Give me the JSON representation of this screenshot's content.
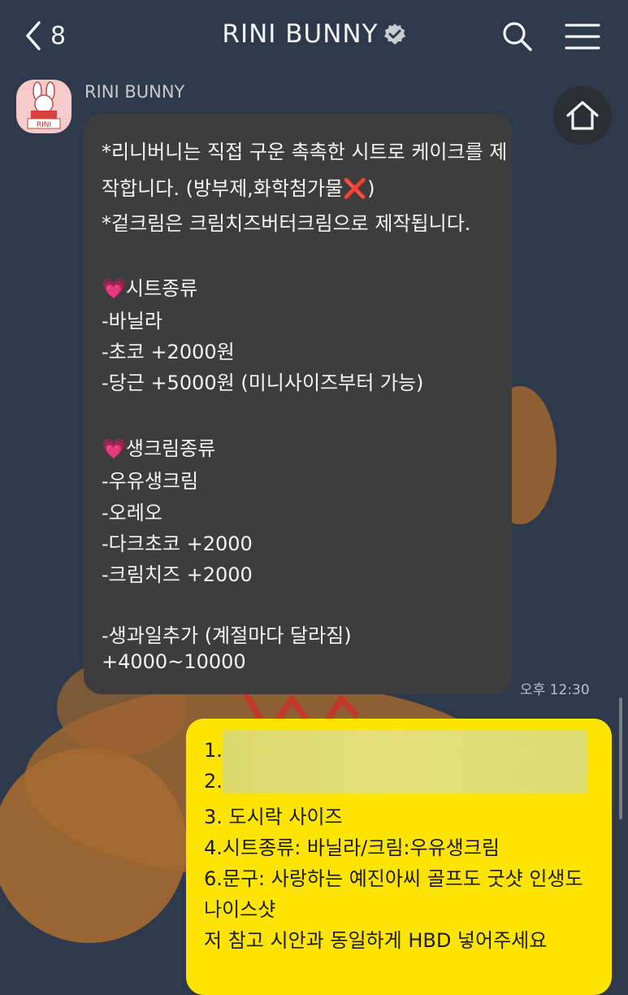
{
  "header": {
    "back_count": "8",
    "title": "RINI BUNNY",
    "icons": {
      "back": "chevron-left-icon",
      "verified": "verified-badge-icon",
      "search": "search-icon",
      "menu": "hamburger-menu-icon",
      "home": "home-icon"
    }
  },
  "incoming": {
    "sender": "RINI BUNNY",
    "avatar_text": "RINI",
    "lines": [
      "*리니버니는 직접 구운 촉촉한 시트로 케이크를 제",
      "작합니다. (방부제,화학첨가물❌)",
      "*겉크림은 크림치즈버터크림으로 제작됩니다.",
      "",
      "💗시트종류",
      "-바닐라",
      "-초코 +2000원",
      "-당근 +5000원 (미니사이즈부터 가능)",
      "",
      "💗생크림종류",
      "-우유생크림",
      "-오레오",
      "-다크초코 +2000",
      "-크림치즈 +2000",
      "",
      "-생과일추가 (계절마다 달라짐)",
      "+4000~10000"
    ],
    "time": "오후 12:30"
  },
  "outgoing": {
    "lines": [
      "1.",
      "2.",
      "3. 도시락 사이즈",
      "4.시트종류: 바닐라/크림:우유생크림",
      "6.문구: 사랑하는 예진아씨 골프도 굿샷 인생도",
      "나이스샷",
      "저 참고 시안과 동일하게 HBD 넣어주세요"
    ]
  },
  "colors": {
    "background": "#2e3a4c",
    "incoming_bubble": "#3d3d3d",
    "outgoing_bubble": "#fee500",
    "avatar_bg": "#f6c9cb"
  }
}
